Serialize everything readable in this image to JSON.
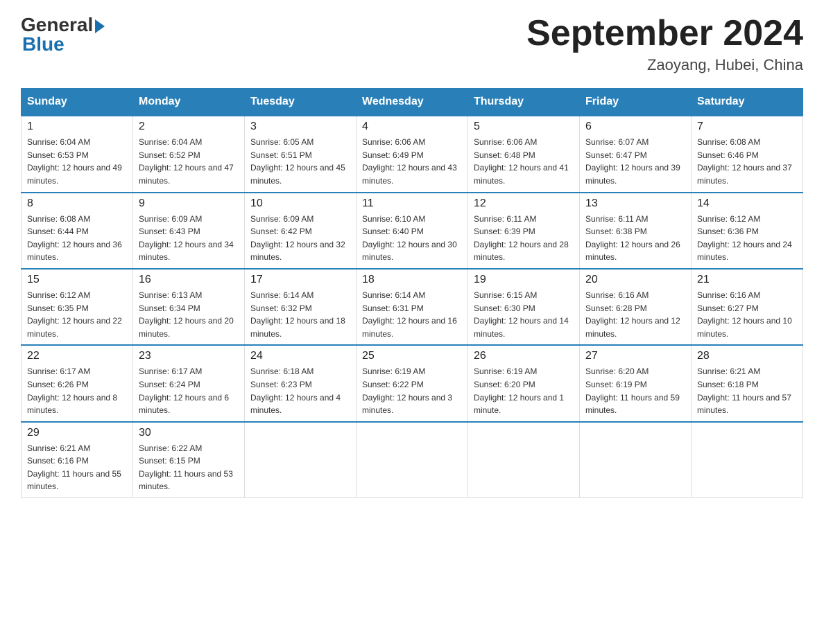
{
  "logo": {
    "general": "General",
    "blue": "Blue"
  },
  "title": "September 2024",
  "location": "Zaoyang, Hubei, China",
  "days_of_week": [
    "Sunday",
    "Monday",
    "Tuesday",
    "Wednesday",
    "Thursday",
    "Friday",
    "Saturday"
  ],
  "weeks": [
    [
      {
        "day": "1",
        "sunrise": "6:04 AM",
        "sunset": "6:53 PM",
        "daylight": "12 hours and 49 minutes."
      },
      {
        "day": "2",
        "sunrise": "6:04 AM",
        "sunset": "6:52 PM",
        "daylight": "12 hours and 47 minutes."
      },
      {
        "day": "3",
        "sunrise": "6:05 AM",
        "sunset": "6:51 PM",
        "daylight": "12 hours and 45 minutes."
      },
      {
        "day": "4",
        "sunrise": "6:06 AM",
        "sunset": "6:49 PM",
        "daylight": "12 hours and 43 minutes."
      },
      {
        "day": "5",
        "sunrise": "6:06 AM",
        "sunset": "6:48 PM",
        "daylight": "12 hours and 41 minutes."
      },
      {
        "day": "6",
        "sunrise": "6:07 AM",
        "sunset": "6:47 PM",
        "daylight": "12 hours and 39 minutes."
      },
      {
        "day": "7",
        "sunrise": "6:08 AM",
        "sunset": "6:46 PM",
        "daylight": "12 hours and 37 minutes."
      }
    ],
    [
      {
        "day": "8",
        "sunrise": "6:08 AM",
        "sunset": "6:44 PM",
        "daylight": "12 hours and 36 minutes."
      },
      {
        "day": "9",
        "sunrise": "6:09 AM",
        "sunset": "6:43 PM",
        "daylight": "12 hours and 34 minutes."
      },
      {
        "day": "10",
        "sunrise": "6:09 AM",
        "sunset": "6:42 PM",
        "daylight": "12 hours and 32 minutes."
      },
      {
        "day": "11",
        "sunrise": "6:10 AM",
        "sunset": "6:40 PM",
        "daylight": "12 hours and 30 minutes."
      },
      {
        "day": "12",
        "sunrise": "6:11 AM",
        "sunset": "6:39 PM",
        "daylight": "12 hours and 28 minutes."
      },
      {
        "day": "13",
        "sunrise": "6:11 AM",
        "sunset": "6:38 PM",
        "daylight": "12 hours and 26 minutes."
      },
      {
        "day": "14",
        "sunrise": "6:12 AM",
        "sunset": "6:36 PM",
        "daylight": "12 hours and 24 minutes."
      }
    ],
    [
      {
        "day": "15",
        "sunrise": "6:12 AM",
        "sunset": "6:35 PM",
        "daylight": "12 hours and 22 minutes."
      },
      {
        "day": "16",
        "sunrise": "6:13 AM",
        "sunset": "6:34 PM",
        "daylight": "12 hours and 20 minutes."
      },
      {
        "day": "17",
        "sunrise": "6:14 AM",
        "sunset": "6:32 PM",
        "daylight": "12 hours and 18 minutes."
      },
      {
        "day": "18",
        "sunrise": "6:14 AM",
        "sunset": "6:31 PM",
        "daylight": "12 hours and 16 minutes."
      },
      {
        "day": "19",
        "sunrise": "6:15 AM",
        "sunset": "6:30 PM",
        "daylight": "12 hours and 14 minutes."
      },
      {
        "day": "20",
        "sunrise": "6:16 AM",
        "sunset": "6:28 PM",
        "daylight": "12 hours and 12 minutes."
      },
      {
        "day": "21",
        "sunrise": "6:16 AM",
        "sunset": "6:27 PM",
        "daylight": "12 hours and 10 minutes."
      }
    ],
    [
      {
        "day": "22",
        "sunrise": "6:17 AM",
        "sunset": "6:26 PM",
        "daylight": "12 hours and 8 minutes."
      },
      {
        "day": "23",
        "sunrise": "6:17 AM",
        "sunset": "6:24 PM",
        "daylight": "12 hours and 6 minutes."
      },
      {
        "day": "24",
        "sunrise": "6:18 AM",
        "sunset": "6:23 PM",
        "daylight": "12 hours and 4 minutes."
      },
      {
        "day": "25",
        "sunrise": "6:19 AM",
        "sunset": "6:22 PM",
        "daylight": "12 hours and 3 minutes."
      },
      {
        "day": "26",
        "sunrise": "6:19 AM",
        "sunset": "6:20 PM",
        "daylight": "12 hours and 1 minute."
      },
      {
        "day": "27",
        "sunrise": "6:20 AM",
        "sunset": "6:19 PM",
        "daylight": "11 hours and 59 minutes."
      },
      {
        "day": "28",
        "sunrise": "6:21 AM",
        "sunset": "6:18 PM",
        "daylight": "11 hours and 57 minutes."
      }
    ],
    [
      {
        "day": "29",
        "sunrise": "6:21 AM",
        "sunset": "6:16 PM",
        "daylight": "11 hours and 55 minutes."
      },
      {
        "day": "30",
        "sunrise": "6:22 AM",
        "sunset": "6:15 PM",
        "daylight": "11 hours and 53 minutes."
      },
      null,
      null,
      null,
      null,
      null
    ]
  ]
}
